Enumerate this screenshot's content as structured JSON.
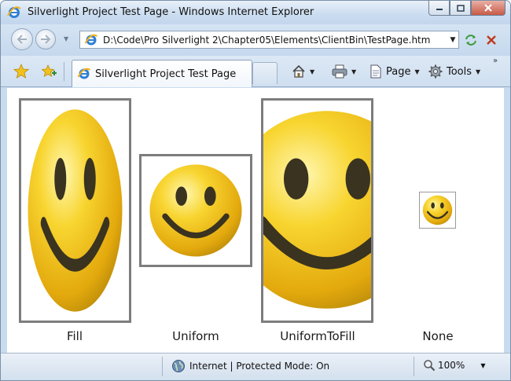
{
  "window": {
    "title": "Silverlight Project Test Page - Windows Internet Explorer",
    "minimize_icon": "minimize-icon",
    "maximize_icon": "maximize-icon",
    "close_icon": "close-icon"
  },
  "navigation": {
    "address": "D:\\Code\\Pro Silverlight 2\\Chapter05\\Elements\\ClientBin\\TestPage.htm",
    "back_icon": "back-arrow-icon",
    "forward_icon": "forward-arrow-icon",
    "refresh_icon": "refresh-icon",
    "stop_icon": "stop-icon"
  },
  "command_bar": {
    "tab_title": "Silverlight Project Test Page",
    "page_label": "Page",
    "tools_label": "Tools",
    "icons": [
      "favorites-star-icon",
      "add-favorites-icon",
      "home-icon",
      "print-icon",
      "page-icon",
      "gear-icon"
    ]
  },
  "content": {
    "images": [
      {
        "caption": "Fill",
        "stretch": "Fill"
      },
      {
        "caption": "Uniform",
        "stretch": "Uniform"
      },
      {
        "caption": "UniformToFill",
        "stretch": "UniformToFill"
      },
      {
        "caption": "None",
        "stretch": "None"
      }
    ]
  },
  "status_bar": {
    "zone_text": "Internet | Protected Mode: On",
    "zoom_text": "100%",
    "zone_icon": "globe-icon",
    "zoom_icon": "magnifier-icon"
  },
  "colors": {
    "chrome_blue": "#c9dcef",
    "smiley_yellow": "#f2c619",
    "frame_gray": "#7d7d7d"
  }
}
